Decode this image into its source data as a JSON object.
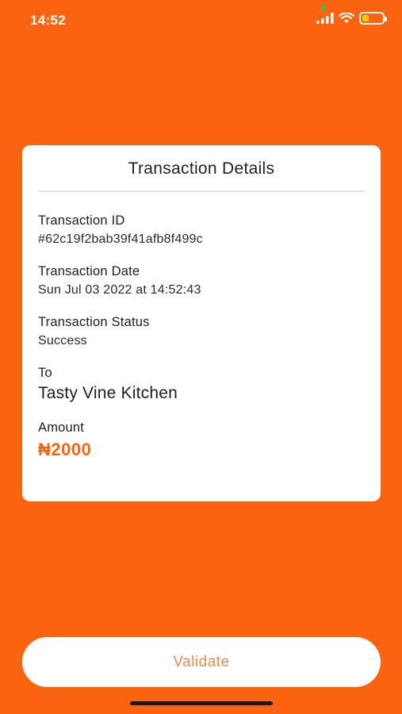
{
  "status_bar": {
    "time": "14:52",
    "icons": [
      "signal-icon",
      "wifi-icon",
      "battery-icon"
    ],
    "battery_color": "#ffcc00"
  },
  "card": {
    "title": "Transaction Details",
    "fields": [
      {
        "label": "Transaction ID",
        "value": "#62c19f2bab39f41afb8f499c"
      },
      {
        "label": "Transaction Date",
        "value": "Sun Jul 03 2022 at 14:52:43"
      },
      {
        "label": "Transaction Status",
        "value": "Success"
      },
      {
        "label": "To",
        "value": "Tasty Vine Kitchen"
      },
      {
        "label": "Amount",
        "value": "₦2000"
      }
    ]
  },
  "actions": {
    "validate_label": "Validate"
  },
  "colors": {
    "background": "#fa6410",
    "accent": "#fa6410",
    "card": "#ffffff"
  }
}
